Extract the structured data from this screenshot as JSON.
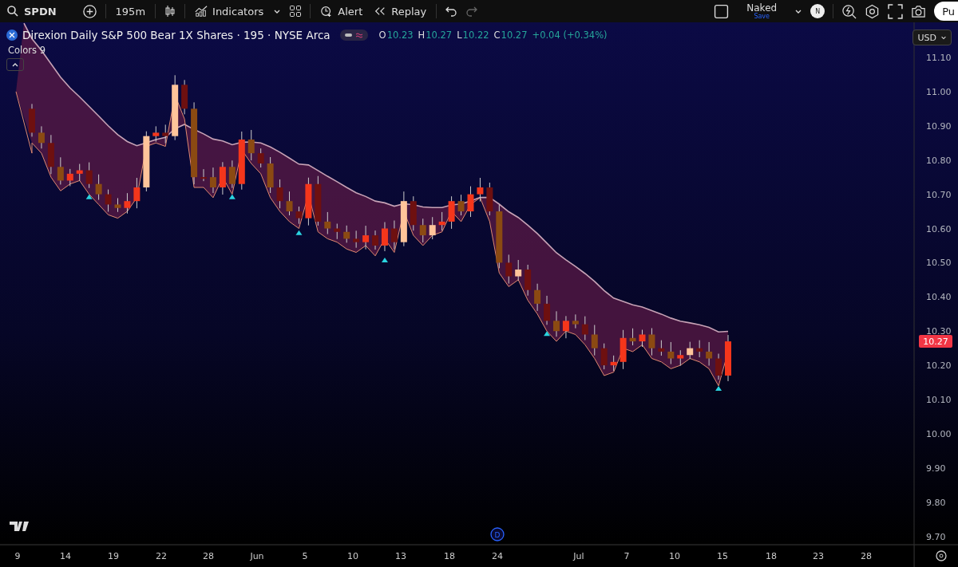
{
  "toolbar": {
    "symbol": "SPDN",
    "interval": "195m",
    "indicators": "Indicators",
    "alert": "Alert",
    "replay": "Replay",
    "layout_name": "Naked",
    "save": "Save",
    "avatar": "N",
    "publish": "Pu"
  },
  "legend": {
    "title": "Direxion Daily S&P 500 Bear 1X Shares · 195 · NYSE Arca",
    "ohlc": [
      {
        "label": "O",
        "value": "10.23"
      },
      {
        "label": "H",
        "value": "10.27"
      },
      {
        "label": "L",
        "value": "10.22"
      },
      {
        "label": "C",
        "value": "10.27"
      }
    ],
    "change": "+0.04 (+0.34%)",
    "indicator": "Colors 9"
  },
  "price_axis": {
    "currency": "USD",
    "ticks": [
      "11.10",
      "11.00",
      "10.90",
      "10.80",
      "10.70",
      "10.60",
      "10.50",
      "10.40",
      "10.30",
      "10.20",
      "10.10",
      "10.00",
      "9.90",
      "9.80",
      "9.70"
    ],
    "last_price": "10.27"
  },
  "time_axis": {
    "ticks": [
      "9",
      "14",
      "19",
      "22",
      "28",
      "Jun",
      "5",
      "10",
      "13",
      "18",
      "24",
      "Jul",
      "7",
      "10",
      "15",
      "18",
      "23",
      "28"
    ]
  },
  "event_marker": "D"
}
